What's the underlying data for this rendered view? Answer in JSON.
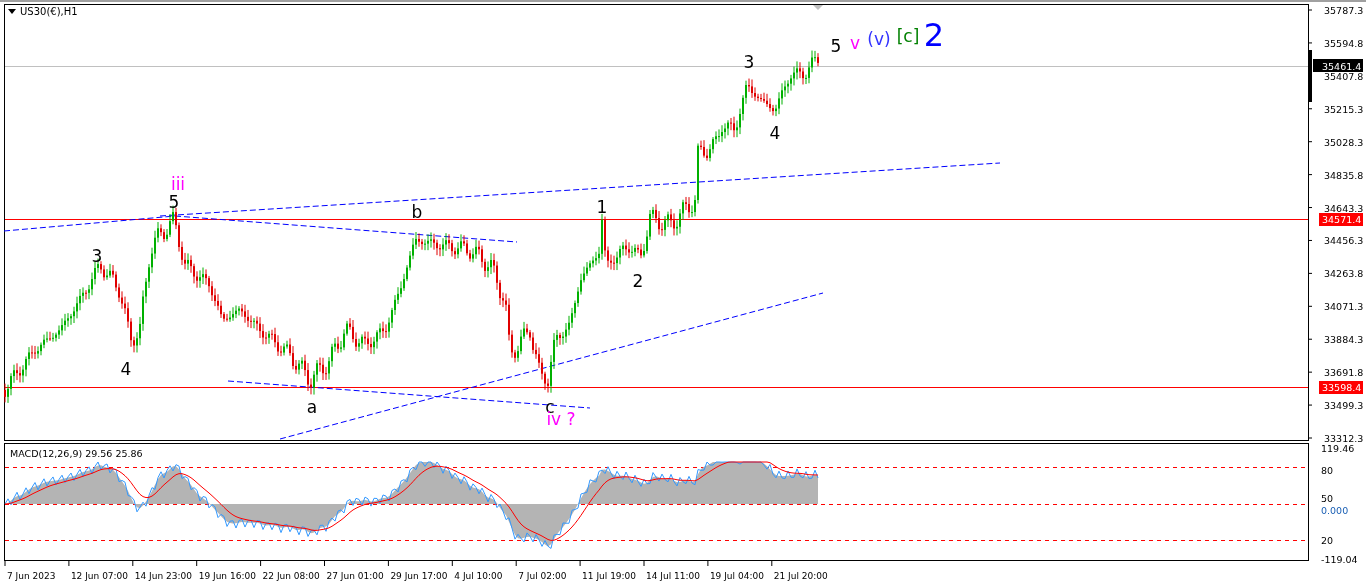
{
  "chart": {
    "symbol": "US30(€),H1",
    "price_ticks": [
      "35787.3",
      "35594.8",
      "35407.8",
      "35215.3",
      "35028.3",
      "34835.8",
      "34643.3",
      "34456.3",
      "34263.8",
      "34071.3",
      "33884.3",
      "33691.8",
      "33499.3",
      "33312.3"
    ],
    "price_levels": [
      {
        "label": "34571.4"
      },
      {
        "label": "33598.4"
      }
    ],
    "current_price": "35461.4",
    "wave_labels": [
      {
        "text": "iii",
        "color": "#ff00ff"
      },
      {
        "text": "5",
        "color": "#000000"
      },
      {
        "text": "3",
        "color": "#000000"
      },
      {
        "text": "4",
        "color": "#000000"
      },
      {
        "text": "b",
        "color": "#000000"
      },
      {
        "text": "a",
        "color": "#000000"
      },
      {
        "text": "1",
        "color": "#000000"
      },
      {
        "text": "2",
        "color": "#000000"
      },
      {
        "text": "c",
        "color": "#000000"
      },
      {
        "text": "iv ?",
        "color": "#ff00ff"
      },
      {
        "text": "3",
        "color": "#000000"
      },
      {
        "text": "4",
        "color": "#000000"
      },
      {
        "text": "5",
        "color": "#000000"
      },
      {
        "text": "v",
        "color": "#ff00ff"
      },
      {
        "text": "(v)",
        "color": "#3333ff"
      },
      {
        "text": "[c]",
        "color": "#008000"
      },
      {
        "text": "2",
        "color": "#0000ff"
      }
    ],
    "time_ticks": [
      "7 Jun 2023",
      "12 Jun 07:00",
      "14 Jun 23:00",
      "19 Jun 16:00",
      "22 Jun 08:00",
      "27 Jun 01:00",
      "29 Jun 17:00",
      "4 Jul 10:00",
      "7 Jul 02:00",
      "11 Jul 19:00",
      "14 Jul 11:00",
      "19 Jul 04:00",
      "21 Jul 20:00"
    ]
  },
  "macd": {
    "title": "MACD(12,26,9) 29.56 25.86",
    "ticks": [
      "119.46",
      "80",
      "50",
      "0.000",
      "20",
      "-119.04"
    ]
  }
}
